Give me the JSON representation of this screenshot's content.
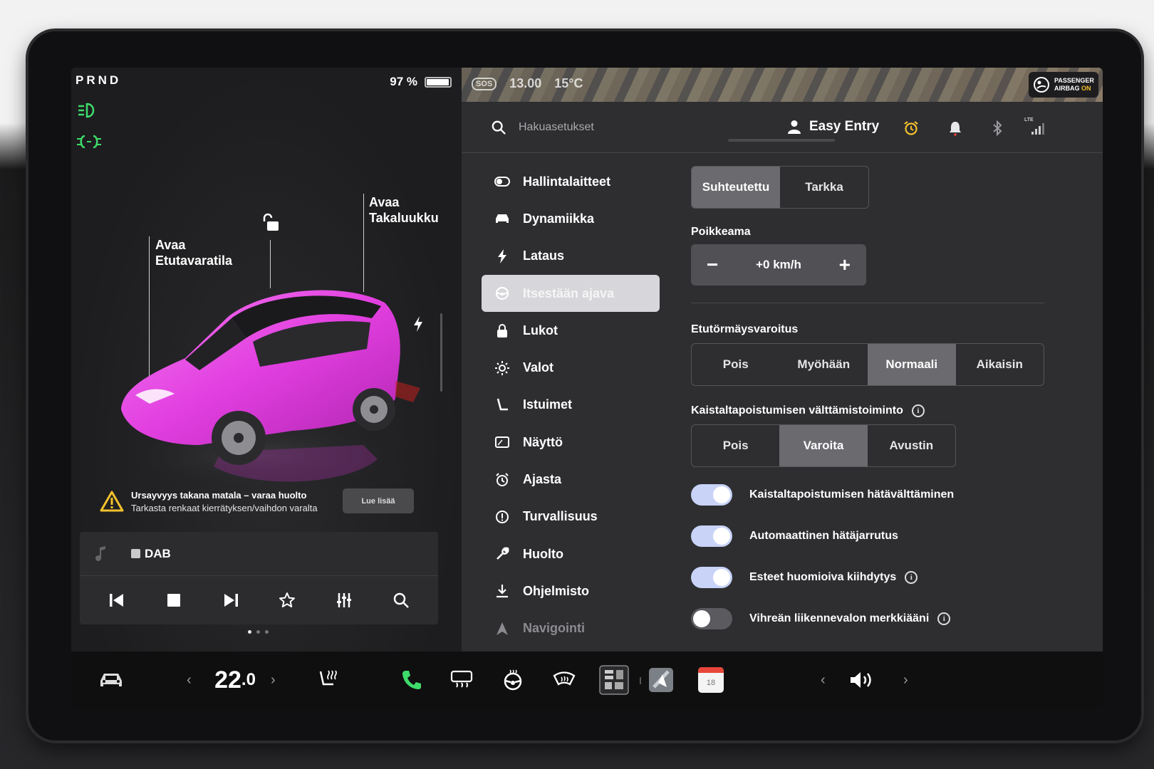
{
  "status": {
    "gear": "PRND",
    "battery_text": "97 %",
    "battery_level": 0.97
  },
  "callouts": {
    "front_trunk": "Avaa\nEtutavaratila",
    "rear_trunk": "Avaa\nTakaluukku"
  },
  "alert": {
    "title": "Ursayvyys takana matala – varaa huolto",
    "subtitle": "Tarkasta renkaat kierrätyksen/vaihdon varalta",
    "button": "Lue lisää"
  },
  "media": {
    "source": "DAB"
  },
  "map_overlay": {
    "sos": "SOS",
    "time": "13.00",
    "temp": "15°C"
  },
  "airbag": {
    "line1": "PASSENGER",
    "line2_prefix": "AIRBAG",
    "line2_state": "ON"
  },
  "topbar": {
    "search_placeholder": "Hakuasetukset",
    "profile": "Easy Entry",
    "lte": "LTE"
  },
  "nav": [
    {
      "label": "Hallintalaitteet",
      "icon": "toggle-icon"
    },
    {
      "label": "Dynamiikka",
      "icon": "car-icon"
    },
    {
      "label": "Lataus",
      "icon": "bolt-icon"
    },
    {
      "label": "Itsestään ajava",
      "icon": "steering-wheel-icon",
      "active": true
    },
    {
      "label": "Lukot",
      "icon": "lock-icon"
    },
    {
      "label": "Valot",
      "icon": "sun-icon"
    },
    {
      "label": "Istuimet",
      "icon": "seat-icon"
    },
    {
      "label": "Näyttö",
      "icon": "display-icon"
    },
    {
      "label": "Ajasta",
      "icon": "alarm-icon"
    },
    {
      "label": "Turvallisuus",
      "icon": "info-circle-icon"
    },
    {
      "label": "Huolto",
      "icon": "wrench-icon"
    },
    {
      "label": "Ohjelmisto",
      "icon": "download-icon"
    },
    {
      "label": "Navigointi",
      "icon": "navigation-icon"
    }
  ],
  "settings": {
    "speed_mode": {
      "options": [
        "Suhteutettu",
        "Tarkka"
      ],
      "selected": "Suhteutettu"
    },
    "offset": {
      "label": "Poikkeama",
      "value": "+0 km/h",
      "minus": "−",
      "plus": "+"
    },
    "forward_collision": {
      "label": "Etutörmäysvaroitus",
      "options": [
        "Pois",
        "Myöhään",
        "Normaali",
        "Aikaisin"
      ],
      "selected": "Normaali"
    },
    "lane_departure": {
      "label": "Kaistaltapoistumisen välttämistoiminto",
      "options": [
        "Pois",
        "Varoita",
        "Avustin"
      ],
      "selected": "Varoita"
    },
    "toggles": [
      {
        "label": "Kaistaltapoistumisen hätävälttäminen",
        "on": true,
        "info": false
      },
      {
        "label": "Automaattinen hätäjarrutus",
        "on": true,
        "info": false
      },
      {
        "label": "Esteet huomioiva kiihdytys",
        "on": true,
        "info": true
      },
      {
        "label": "Vihreän liikennevalon merkkiääni",
        "on": false,
        "info": true
      }
    ]
  },
  "dock": {
    "temp_whole": "22",
    "temp_decimal": ".0",
    "calendar_day": "18"
  },
  "colors": {
    "accent_green": "#3ddc6a",
    "car_pink": "#e23fe0",
    "alarm_yellow": "#f3c12d",
    "toggle_on": "#c8d3f7"
  }
}
